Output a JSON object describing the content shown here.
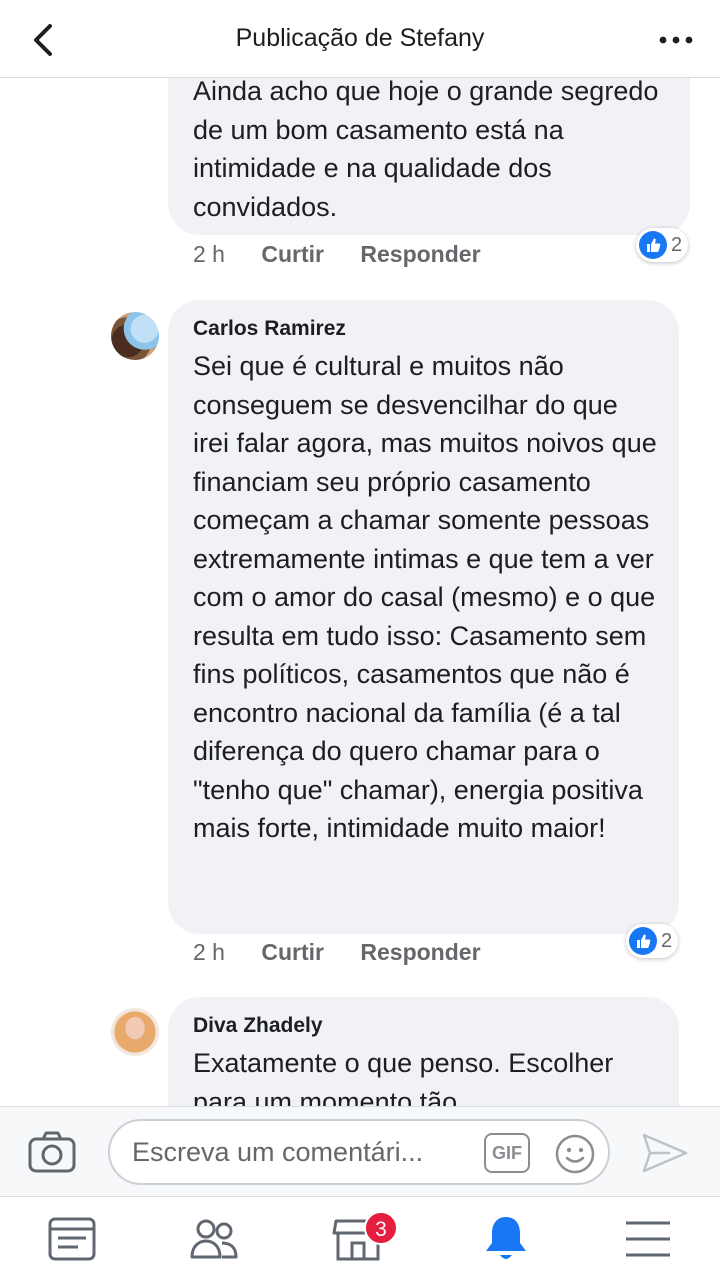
{
  "header": {
    "title": "Publicação de Stefany"
  },
  "comments": [
    {
      "text": "Ainda acho que hoje o grande segredo de um bom casamento está na intimidade e na qualidade dos convidados.",
      "time": "2 h",
      "like_label": "Curtir",
      "reply_label": "Responder",
      "reactions": "2"
    },
    {
      "author": "Carlos Ramirez",
      "text": "Sei que é cultural e muitos não conseguem se desvencilhar do que irei falar agora, mas muitos noivos que financiam seu próprio casamento começam a chamar somente pessoas extremamente intimas e que tem a ver com o amor do casal (mesmo) e o que resulta em tudo isso: Casamento sem fins políticos, casamentos que não é encontro nacional da família (é a tal diferença do quero chamar para o \"tenho que\" chamar), energia positiva mais forte, intimidade muito maior!",
      "time": "2 h",
      "like_label": "Curtir",
      "reply_label": "Responder",
      "reactions": "2"
    },
    {
      "author": "Diva Zhadely",
      "text": "Exatamente o que penso. Escolher para um momento tão"
    }
  ],
  "composer": {
    "placeholder": "Escreva um comentári...",
    "gif_label": "GIF"
  },
  "nav": {
    "marketplace_badge": "3"
  },
  "colors": {
    "accent": "#1877f2",
    "bubble": "#f0f2f5",
    "badge": "#e41e3f",
    "muted": "#65676b"
  }
}
